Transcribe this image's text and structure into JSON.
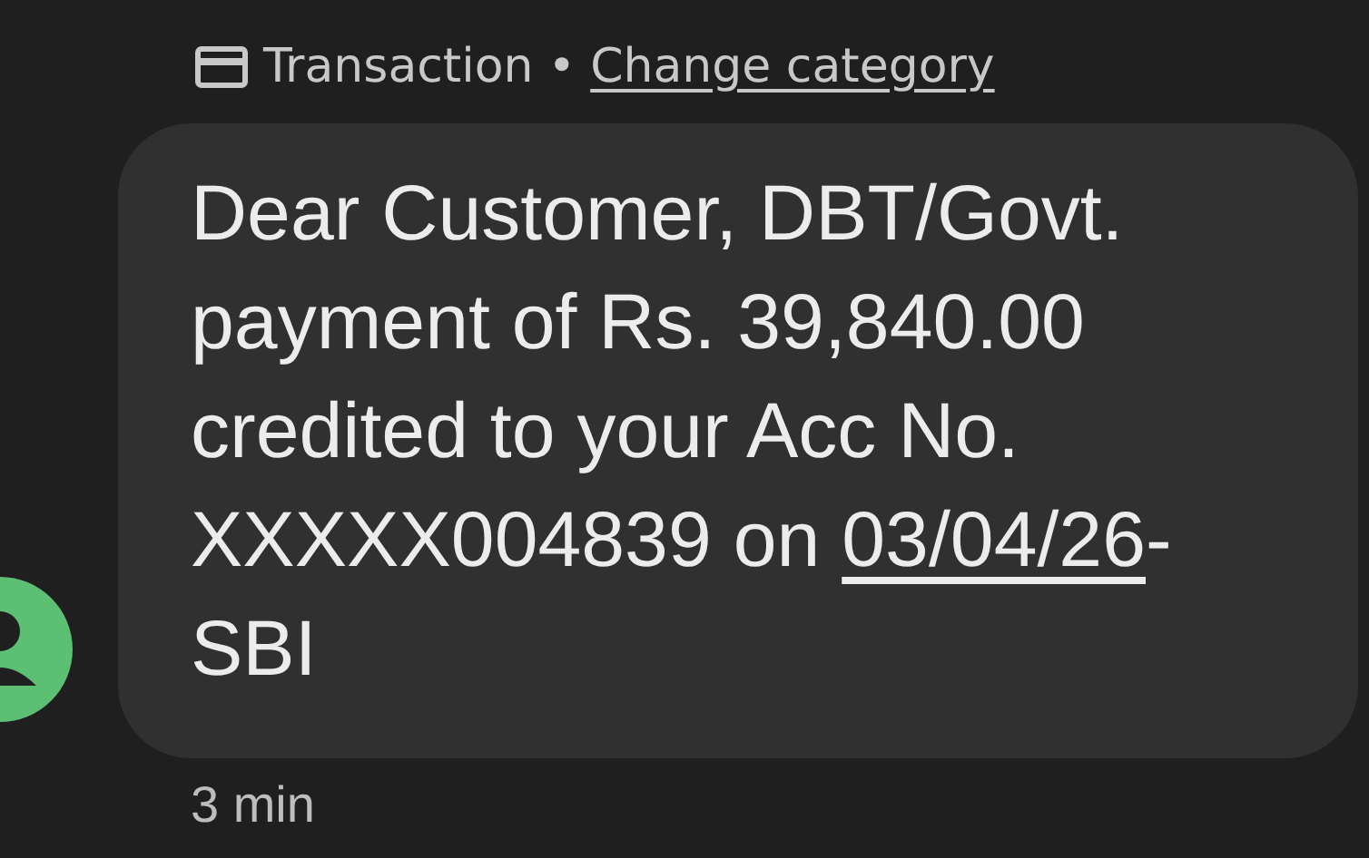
{
  "header": {
    "label": "Transaction",
    "separator": "•",
    "link": "Change category"
  },
  "message": {
    "text_before": "Dear Customer, DBT/Govt. payment of Rs. 39,840.00 credited to your Acc No. XXXXX004839 on ",
    "link": "03/04/26",
    "text_after": "-SBI"
  },
  "timestamp": "3 min"
}
